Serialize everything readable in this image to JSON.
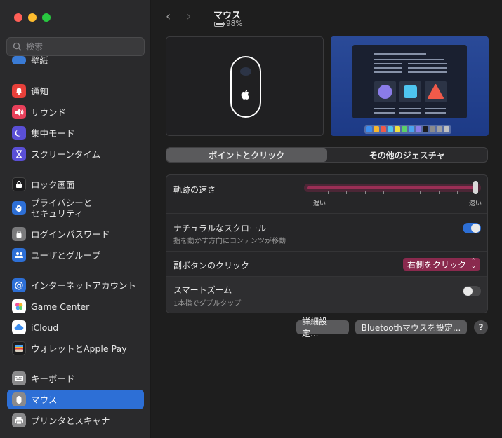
{
  "window": {
    "title": "マウス",
    "battery": "98%",
    "battery_level": 0.98
  },
  "search": {
    "placeholder": "検索"
  },
  "sidebar": {
    "partial_label": "壁紙",
    "items": [
      {
        "label": "通知",
        "icon": "bell-icon",
        "color": "#e8403a"
      },
      {
        "label": "サウンド",
        "icon": "speaker-icon",
        "color": "#e8405a"
      },
      {
        "label": "集中モード",
        "icon": "moon-icon",
        "color": "#5a4fd6"
      },
      {
        "label": "スクリーンタイム",
        "icon": "hourglass-icon",
        "color": "#5a4fd6"
      },
      {
        "label": "ロック画面",
        "icon": "lock-screen-icon",
        "color": "#1c1c1e"
      },
      {
        "label": "プライバシーと\nセキュリティ",
        "icon": "hand-icon",
        "color": "#2d6fd6"
      },
      {
        "label": "ログインパスワード",
        "icon": "lock-icon",
        "color": "#7a7a7c"
      },
      {
        "label": "ユーザとグループ",
        "icon": "users-icon",
        "color": "#2d6fd6"
      },
      {
        "label": "インターネットアカウント",
        "icon": "at-icon",
        "color": "#2d6fd6"
      },
      {
        "label": "Game Center",
        "icon": "game-center-icon",
        "color": "#ffffff"
      },
      {
        "label": "iCloud",
        "icon": "cloud-icon",
        "color": "#ffffff"
      },
      {
        "label": "ウォレットとApple Pay",
        "icon": "wallet-icon",
        "color": "#1c1c1e"
      },
      {
        "label": "キーボード",
        "icon": "keyboard-icon",
        "color": "#8a8a8c"
      },
      {
        "label": "マウス",
        "icon": "mouse-icon",
        "color": "#8a8a8c",
        "selected": true
      },
      {
        "label": "プリンタとスキャナ",
        "icon": "printer-icon",
        "color": "#8a8a8c"
      }
    ]
  },
  "tabs": {
    "point_click": "ポイントとクリック",
    "more_gestures": "その他のジェスチャ",
    "active": 0
  },
  "settings": {
    "tracking_speed": {
      "label": "軌跡の速さ",
      "slow": "遅い",
      "fast": "速い",
      "value": 1.0
    },
    "natural_scroll": {
      "label": "ナチュラルなスクロール",
      "sub": "指を動かす方向にコンテンツが移動",
      "on": true
    },
    "secondary_click": {
      "label": "副ボタンのクリック",
      "value": "右側をクリック"
    },
    "smart_zoom": {
      "label": "スマートズーム",
      "sub": "1本指でダブルタップ",
      "on": false
    }
  },
  "buttons": {
    "advanced": "詳細設定...",
    "bluetooth": "Bluetoothマウスを設定...",
    "help": "?"
  },
  "colors": {
    "accent": "#2d6fd6",
    "highlight": "#9a2e55"
  }
}
